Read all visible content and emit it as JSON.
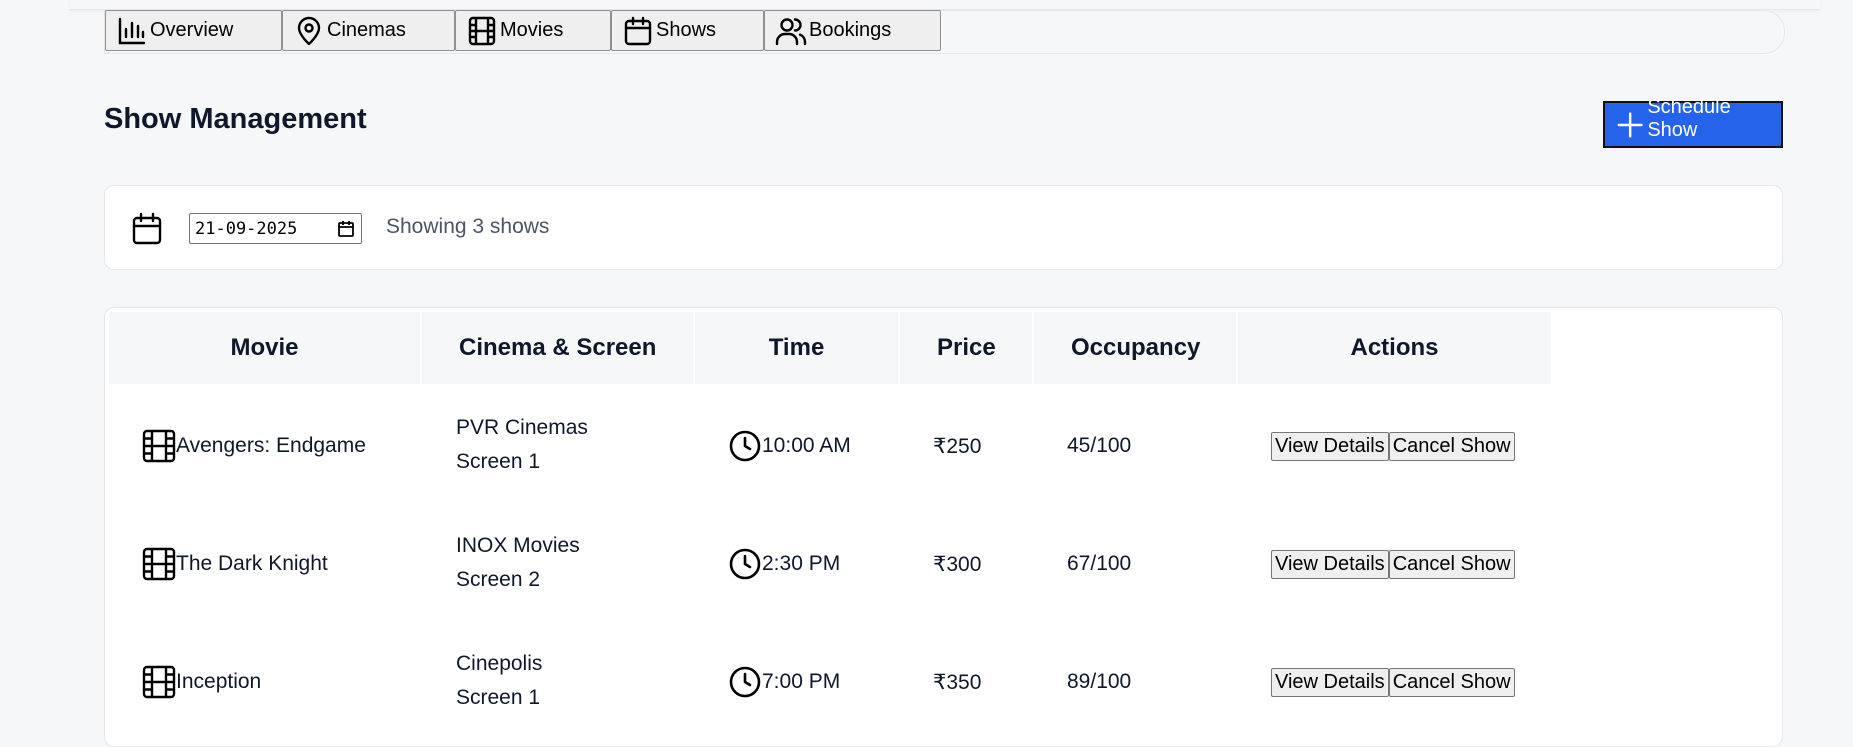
{
  "tabs": [
    {
      "label": "Overview",
      "icon": "chart-bar-icon"
    },
    {
      "label": "Cinemas",
      "icon": "map-pin-icon"
    },
    {
      "label": "Movies",
      "icon": "film-icon"
    },
    {
      "label": "Shows",
      "icon": "calendar-icon"
    },
    {
      "label": "Bookings",
      "icon": "users-icon"
    }
  ],
  "page": {
    "title": "Show Management",
    "primary_action": "Schedule Show"
  },
  "filter": {
    "date_value": "21-09-2025",
    "count_text": "Showing 3 shows"
  },
  "table": {
    "headers": [
      "Movie",
      "Cinema & Screen",
      "Time",
      "Price",
      "Occupancy",
      "Actions"
    ],
    "rows": [
      {
        "movie": "Avengers: Endgame",
        "cinema": "PVR Cinemas",
        "screen": "Screen 1",
        "time": "10:00 AM",
        "price": "₹250",
        "occupancy": "45/100",
        "view": "View Details",
        "cancel": "Cancel Show"
      },
      {
        "movie": "The Dark Knight",
        "cinema": "INOX Movies",
        "screen": "Screen 2",
        "time": "2:30 PM",
        "price": "₹300",
        "occupancy": "67/100",
        "view": "View Details",
        "cancel": "Cancel Show"
      },
      {
        "movie": "Inception",
        "cinema": "Cinepolis",
        "screen": "Screen 1",
        "time": "7:00 PM",
        "price": "₹350",
        "occupancy": "89/100",
        "view": "View Details",
        "cancel": "Cancel Show"
      }
    ]
  },
  "colors": {
    "primary": "#2563eb",
    "background": "#f6f7f9"
  }
}
